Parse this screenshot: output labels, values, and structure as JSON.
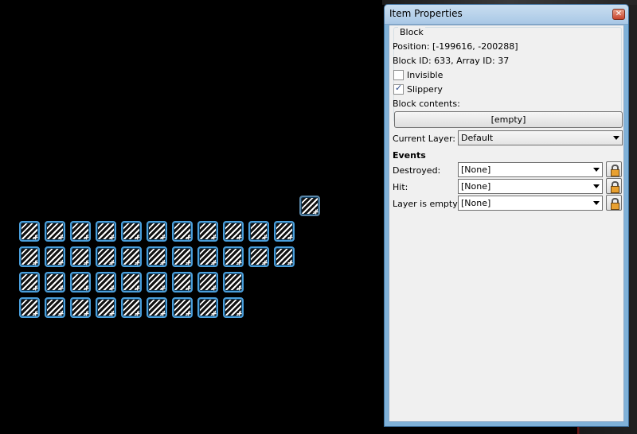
{
  "dialog": {
    "title": "Item Properties",
    "group_label": "Block",
    "position_text": "Position: [-199616, -200288]",
    "block_id_text": "Block ID: 633, Array ID: 37",
    "invisible_label": "Invisible",
    "invisible_checked": false,
    "slippery_label": "Slippery",
    "slippery_checked": true,
    "block_contents_label": "Block contents:",
    "block_contents_button": "[empty]",
    "current_layer_label": "Current Layer:",
    "current_layer_value": "Default",
    "events_heading": "Events",
    "events": [
      {
        "label": "Destroyed:",
        "value": "[None]"
      },
      {
        "label": "Hit:",
        "value": "[None]"
      },
      {
        "label": "Layer is empty:",
        "value": "[None]"
      }
    ]
  },
  "icons": {
    "close": "close-icon",
    "lock": "lock-icon",
    "tile": "slippery-block-tile"
  },
  "colors": {
    "accent": "#4a9fdc",
    "dialog_frame": "#7fb1d8",
    "close_button": "#c8442c"
  }
}
